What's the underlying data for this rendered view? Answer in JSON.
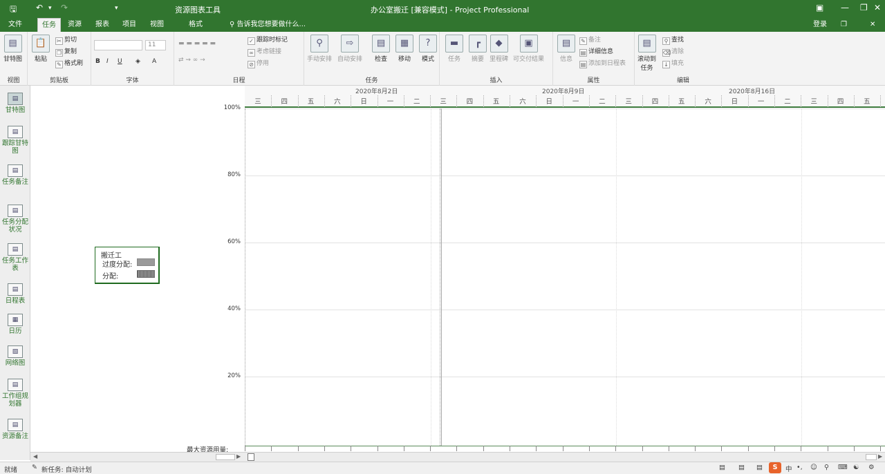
{
  "window": {
    "title": "办公室搬迁 [兼容模式] - Project Professional",
    "context_tab": "资源图表工具",
    "signin": "登录"
  },
  "tabs": [
    {
      "label": "文件"
    },
    {
      "label": "任务"
    },
    {
      "label": "资源"
    },
    {
      "label": "报表"
    },
    {
      "label": "项目"
    },
    {
      "label": "视图"
    },
    {
      "label": "格式"
    }
  ],
  "tellme": "告诉我您想要做什么...",
  "ribbon": {
    "groups": {
      "view": "视图",
      "clipboard": "剪贴板",
      "font": "字体",
      "schedule": "日程",
      "tasks": "任务",
      "insert": "插入",
      "properties": "属性",
      "editing": "编辑"
    },
    "gantt": "甘特图",
    "paste": "粘贴",
    "cut": "剪切",
    "copy": "复制",
    "format_painter": "格式刷",
    "font_size": "11",
    "mark_on_track": "跟踪时标记",
    "respect_links": "考虑链接",
    "inactivate": "停用",
    "manual": "手动安排",
    "auto": "自动安排",
    "inspect": "检查",
    "move": "移动",
    "mode": "模式",
    "task": "任务",
    "summary": "摘要",
    "milestone": "里程碑",
    "deliverable": "可交付结果",
    "info": "信息",
    "notes": "备注",
    "details": "详细信息",
    "add_timeline": "添加到日程表",
    "scroll_to": "滚动到",
    "scroll_to2": "任务",
    "find": "查找",
    "clear": "清除",
    "fill": "填充"
  },
  "sidebar": [
    {
      "label": "甘特图",
      "icon": "gantt-icon"
    },
    {
      "label": "跟踪甘特图",
      "icon": "tracking-gantt-icon"
    },
    {
      "label": "任务备注",
      "icon": "task-notes-icon"
    },
    {
      "label": "任务分配状况",
      "icon": "task-usage-icon"
    },
    {
      "label": "任务工作表",
      "icon": "task-sheet-icon"
    },
    {
      "label": "日程表",
      "icon": "timeline-icon"
    },
    {
      "label": "日历",
      "icon": "calendar-icon"
    },
    {
      "label": "网络图",
      "icon": "network-icon"
    },
    {
      "label": "工作组规划器",
      "icon": "team-planner-icon"
    },
    {
      "label": "资源备注",
      "icon": "resource-notes-icon"
    }
  ],
  "legend": {
    "title": "搬迁工",
    "overallocated": "过度分配:",
    "allocated": "分配:"
  },
  "timescale": {
    "weeks": [
      "2020年8月2日",
      "2020年8月9日",
      "2020年8月16日"
    ],
    "days": [
      "三",
      "四",
      "五",
      "六",
      "日",
      "一",
      "二",
      "三",
      "四",
      "五",
      "六",
      "日",
      "一",
      "二",
      "三",
      "四",
      "五",
      "六",
      "日",
      "一",
      "二",
      "三",
      "四",
      "五"
    ]
  },
  "chart_data": {
    "type": "bar",
    "y_ticks": [
      "100%",
      "80%",
      "60%",
      "40%",
      "20%"
    ],
    "ylim": [
      0,
      100
    ],
    "max_units_label": "最大资源用量:",
    "series": []
  },
  "status": {
    "ready": "就绪",
    "new_tasks": "新任务: 自动计划"
  },
  "colors": {
    "accent": "#31752f",
    "ribbon": "#f3f3f3"
  }
}
